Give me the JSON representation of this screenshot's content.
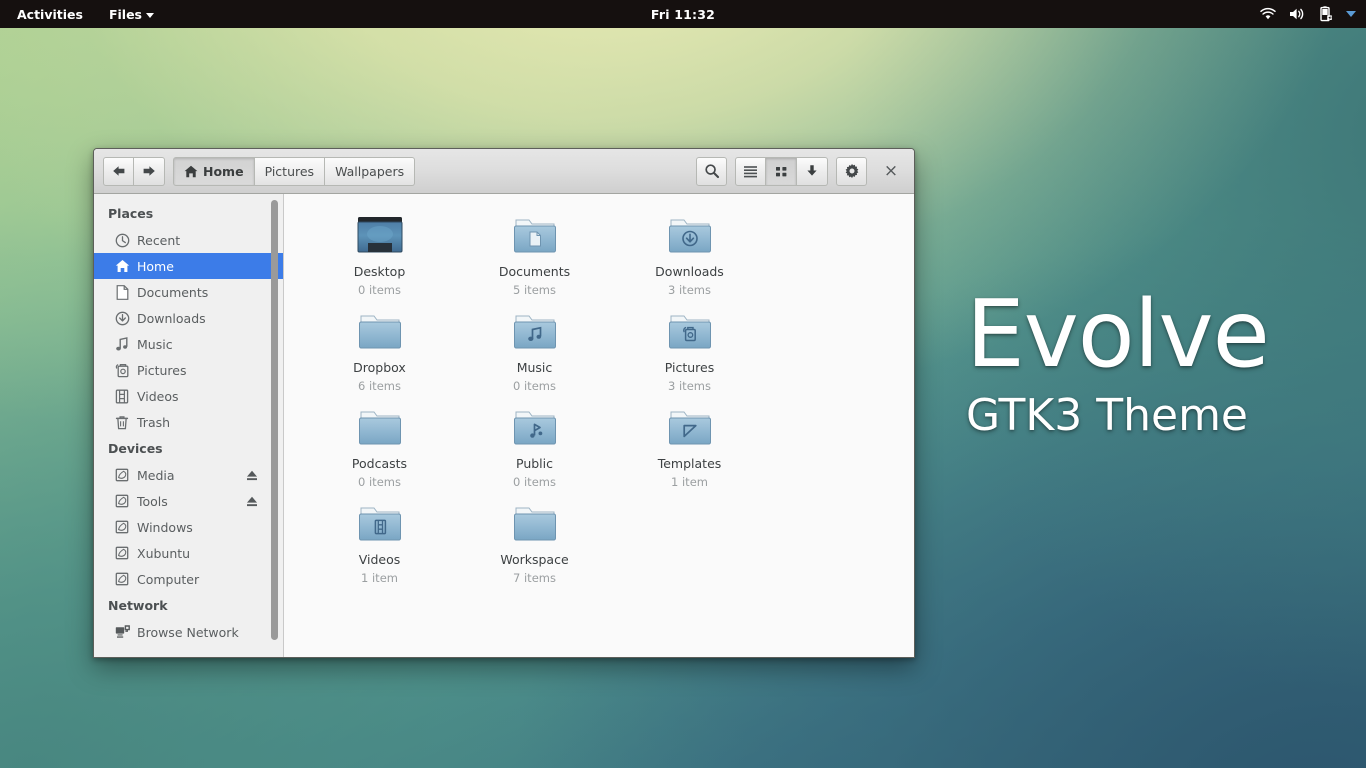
{
  "topbar": {
    "activities_label": "Activities",
    "app_menu_label": "Files",
    "clock": "Fri 11:32",
    "indicators": [
      {
        "name": "wifi-icon",
        "label": "wifi"
      },
      {
        "name": "volume-icon",
        "label": "volume"
      },
      {
        "name": "battery-icon",
        "label": "battery"
      },
      {
        "name": "chevron-down-icon",
        "label": "system menu"
      }
    ]
  },
  "window": {
    "nav": {
      "back": "Back",
      "forward": "Forward"
    },
    "breadcrumbs": [
      {
        "label": "Home",
        "icon": "home-icon",
        "current": true
      },
      {
        "label": "Pictures",
        "icon": "",
        "current": false
      },
      {
        "label": "Wallpapers",
        "icon": "",
        "current": false
      }
    ],
    "toolbar": {
      "search_label": "Search",
      "list_view_label": "List view",
      "grid_view_label": "Grid view",
      "downloads_label": "Downloads",
      "settings_label": "Settings",
      "close_label": "×"
    },
    "sidebar": {
      "sections": [
        {
          "title": "Places",
          "items": [
            {
              "label": "Recent",
              "icon": "recent-icon",
              "selected": false,
              "eject": false
            },
            {
              "label": "Home",
              "icon": "home-icon",
              "selected": true,
              "eject": false
            },
            {
              "label": "Documents",
              "icon": "document-icon",
              "selected": false,
              "eject": false
            },
            {
              "label": "Downloads",
              "icon": "download-icon",
              "selected": false,
              "eject": false
            },
            {
              "label": "Music",
              "icon": "music-icon",
              "selected": false,
              "eject": false
            },
            {
              "label": "Pictures",
              "icon": "pictures-icon",
              "selected": false,
              "eject": false
            },
            {
              "label": "Videos",
              "icon": "video-icon",
              "selected": false,
              "eject": false
            },
            {
              "label": "Trash",
              "icon": "trash-icon",
              "selected": false,
              "eject": false
            }
          ]
        },
        {
          "title": "Devices",
          "items": [
            {
              "label": "Media",
              "icon": "drive-icon",
              "selected": false,
              "eject": true
            },
            {
              "label": "Tools",
              "icon": "drive-icon",
              "selected": false,
              "eject": true
            },
            {
              "label": "Windows",
              "icon": "drive-icon",
              "selected": false,
              "eject": false
            },
            {
              "label": "Xubuntu",
              "icon": "drive-icon",
              "selected": false,
              "eject": false
            },
            {
              "label": "Computer",
              "icon": "drive-icon",
              "selected": false,
              "eject": false
            }
          ]
        },
        {
          "title": "Network",
          "items": [
            {
              "label": "Browse Network",
              "icon": "network-icon",
              "selected": false,
              "eject": false
            }
          ]
        }
      ]
    },
    "files": [
      {
        "name": "Desktop",
        "count": "0 items",
        "icon": "desktop-icon"
      },
      {
        "name": "Documents",
        "count": "5 items",
        "icon": "folder-documents-icon"
      },
      {
        "name": "Downloads",
        "count": "3 items",
        "icon": "folder-downloads-icon"
      },
      {
        "name": "Dropbox",
        "count": "6 items",
        "icon": "folder-icon"
      },
      {
        "name": "Music",
        "count": "0 items",
        "icon": "folder-music-icon"
      },
      {
        "name": "Pictures",
        "count": "3 items",
        "icon": "folder-pictures-icon"
      },
      {
        "name": "Podcasts",
        "count": "0 items",
        "icon": "folder-icon"
      },
      {
        "name": "Public",
        "count": "0 items",
        "icon": "folder-public-icon"
      },
      {
        "name": "Templates",
        "count": "1 item",
        "icon": "folder-templates-icon"
      },
      {
        "name": "Videos",
        "count": "1 item",
        "icon": "folder-videos-icon"
      },
      {
        "name": "Workspace",
        "count": "7 items",
        "icon": "folder-icon"
      }
    ]
  },
  "watermark": {
    "title": "Evolve",
    "subtitle": "GTK3 Theme"
  },
  "colors": {
    "selection": "#3c7ce8",
    "topbar_bg": "#15100f",
    "titlebar_bg": "#dedede",
    "sidebar_bg": "#f0f0f0",
    "content_bg": "#fafafa",
    "folder_blue": "#84afd0"
  }
}
